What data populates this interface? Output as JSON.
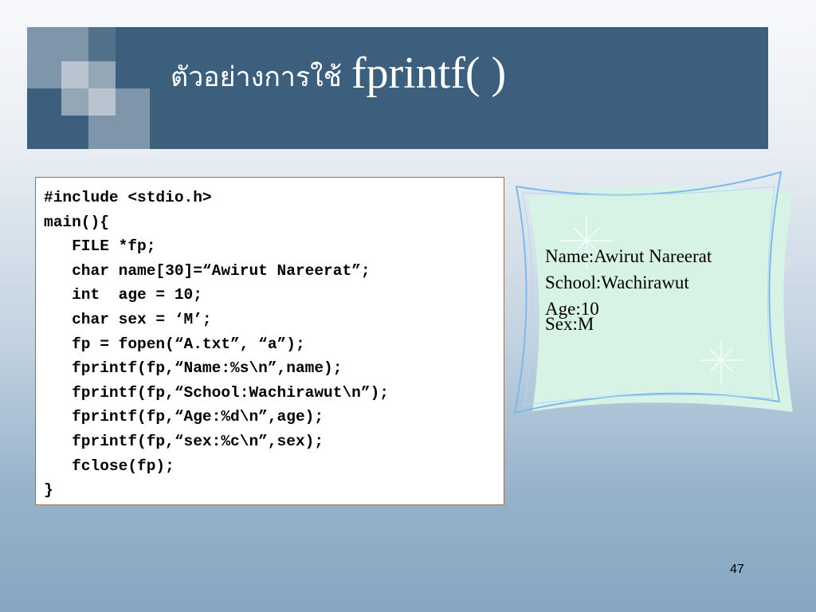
{
  "slide": {
    "title_thai": "ตัวอย่างการใช้",
    "title_function": "fprintf( )",
    "page_number": "47"
  },
  "code": {
    "lines": [
      "#include <stdio.h>",
      "main(){",
      "   FILE *fp;",
      "   char name[30]=“Awirut Nareerat”;",
      "   int  age = 10;",
      "   char sex = ‘M’;",
      "   fp = fopen(“A.txt”, “a”);",
      "   fprintf(fp,“Name:%s\\n”,name);",
      "   fprintf(fp,“School:Wachirawut\\n”);",
      "   fprintf(fp,“Age:%d\\n”,age);",
      "   fprintf(fp,“sex:%c\\n”,sex);",
      "   fclose(fp);",
      "}"
    ]
  },
  "output": {
    "lines": [
      "Name:Awirut Nareerat",
      "School:Wachirawut",
      "Age:10",
      "Sex:M"
    ]
  },
  "colors": {
    "title_bar": "#3b5f7d",
    "code_border": "#b0664b",
    "output_fill": "#d7f3e6",
    "output_outline": "#7fb8ec"
  }
}
